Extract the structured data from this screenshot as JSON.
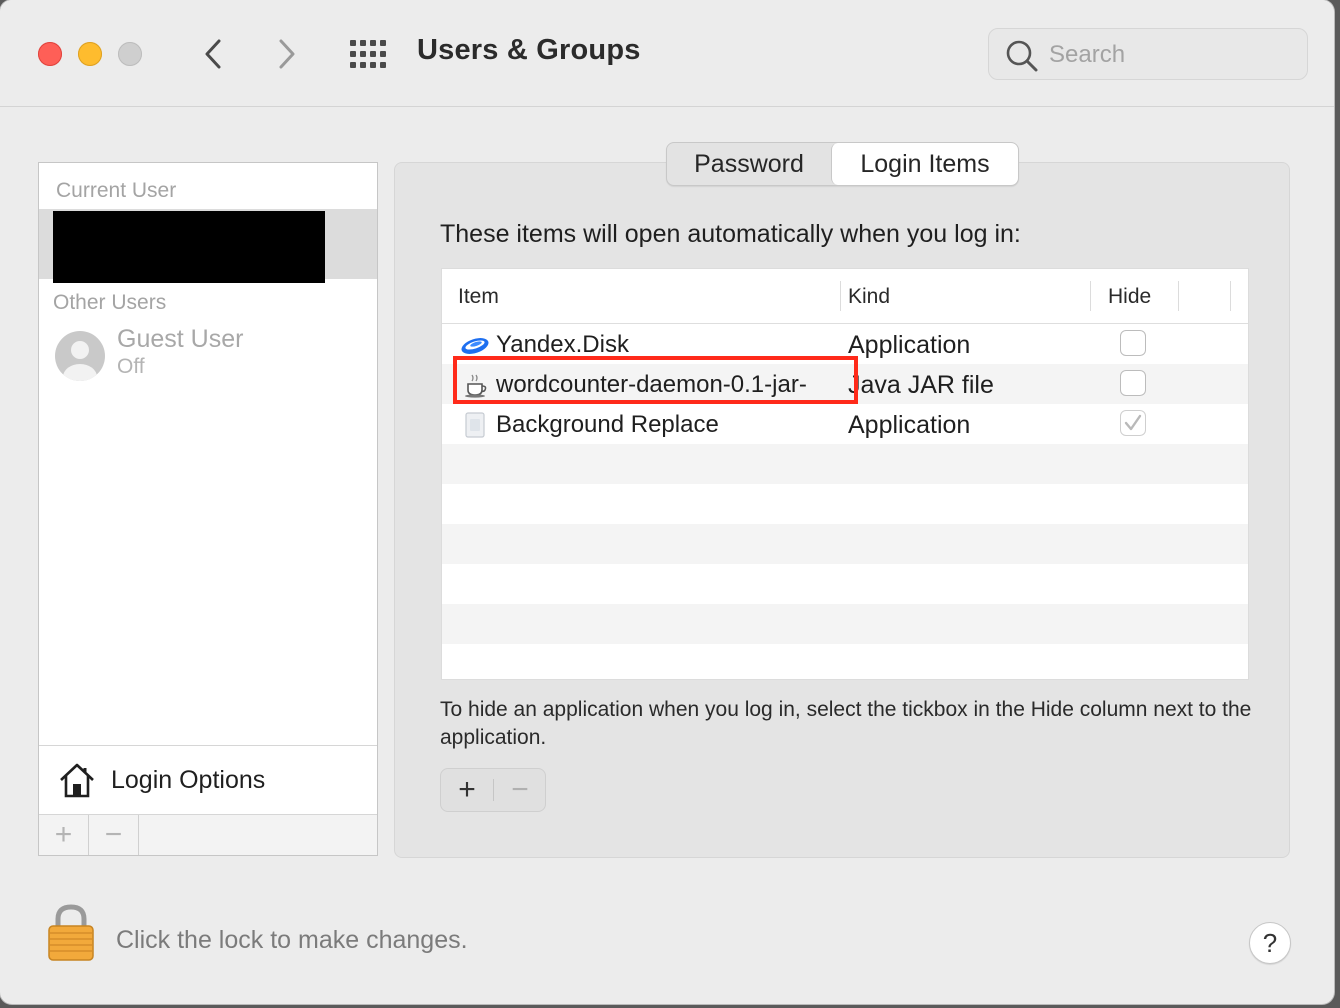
{
  "window": {
    "title": "Users & Groups",
    "search": {
      "placeholder": "Search",
      "value": ""
    }
  },
  "sidebar": {
    "current_user_label": "Current User",
    "other_users_label": "Other Users",
    "guest": {
      "name": "Guest User",
      "status": "Off"
    },
    "login_options_label": "Login Options",
    "add_label": "+",
    "remove_label": "−"
  },
  "tabs": [
    {
      "label": "Password",
      "selected": false
    },
    {
      "label": "Login Items",
      "selected": true
    }
  ],
  "login_items": {
    "intro": "These items will open automatically when you log in:",
    "columns": {
      "item": "Item",
      "kind": "Kind",
      "hide": "Hide"
    },
    "rows": [
      {
        "name": "Yandex.Disk",
        "kind": "Application",
        "hide": false,
        "icon": "yandex-disk-icon"
      },
      {
        "name": "wordcounter-daemon-0.1-jar-",
        "kind": "Java JAR file",
        "hide": false,
        "icon": "java-jar-icon"
      },
      {
        "name": "Background Replace",
        "kind": "Application",
        "hide": true,
        "icon": "app-document-icon"
      }
    ],
    "help": "To hide an application when you log in, select the tickbox in the Hide column next to the application.",
    "add_label": "+",
    "remove_label": "−"
  },
  "footer": {
    "lock_text": "Click the lock to make changes.",
    "help_label": "?"
  },
  "colors": {
    "highlight": "#ff2a1a",
    "close": "#fe5f57",
    "minimize": "#febc2e"
  }
}
